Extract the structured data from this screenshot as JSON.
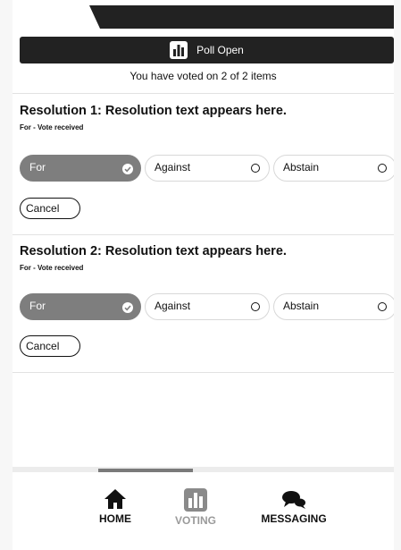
{
  "poll": {
    "status": "Poll Open",
    "voted_text": "You have voted on 2 of 2 items"
  },
  "resolutions": [
    {
      "title": "Resolution 1: Resolution text appears here.",
      "status": "For - Vote received",
      "options": [
        "For",
        "Against",
        "Abstain"
      ],
      "selected": "For",
      "cancel_label": "Cancel"
    },
    {
      "title": "Resolution 2: Resolution text appears here.",
      "status": "For - Vote received",
      "options": [
        "For",
        "Against",
        "Abstain"
      ],
      "selected": "For",
      "cancel_label": "Cancel"
    }
  ],
  "nav": {
    "home": "HOME",
    "voting": "VOTING",
    "messaging": "MESSAGING",
    "active": "voting"
  },
  "colors": {
    "dark": "#222222",
    "selected": "#7e7e7e",
    "muted": "#9a9a9a"
  }
}
